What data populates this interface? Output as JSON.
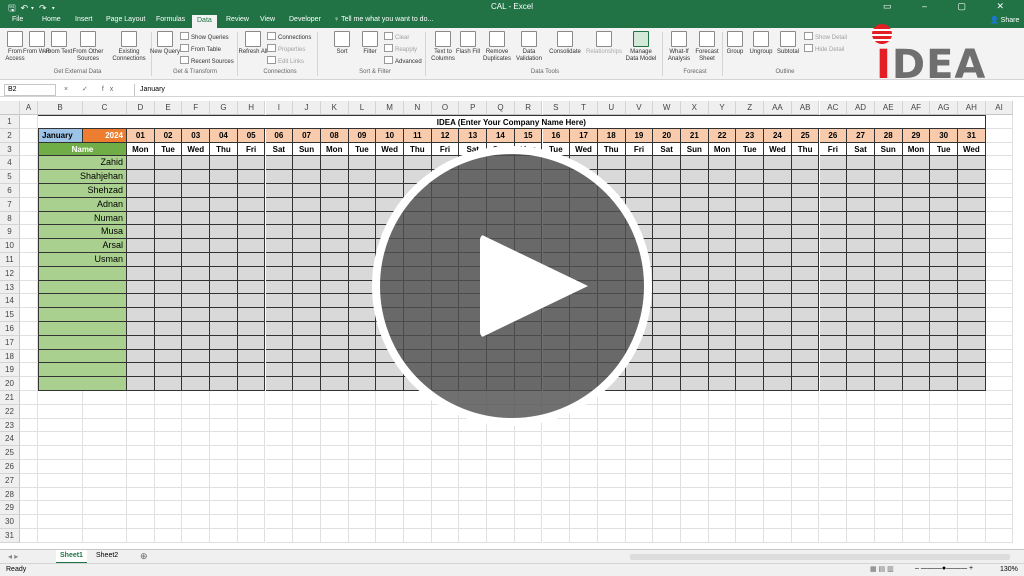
{
  "window": {
    "title": "CAL - Excel"
  },
  "ribbon_tabs": [
    "File",
    "Home",
    "Insert",
    "Page Layout",
    "Formulas",
    "Data",
    "Review",
    "View",
    "Developer"
  ],
  "active_tab": "Data",
  "tell_me": "Tell me what you want to do...",
  "share": "Share",
  "ribbon": {
    "get_external": {
      "label": "Get External Data",
      "buttons": [
        "From Access",
        "From Web",
        "From Text",
        "From Other Sources",
        "Existing Connections"
      ]
    },
    "get_transform": {
      "label": "Get & Transform",
      "new_query": "New Query",
      "show_queries": "Show Queries",
      "from_table": "From Table",
      "recent_sources": "Recent Sources"
    },
    "connections": {
      "label": "Connections",
      "refresh_all": "Refresh All",
      "connections": "Connections",
      "properties": "Properties",
      "edit_links": "Edit Links"
    },
    "sort_filter": {
      "label": "Sort & Filter",
      "sort": "Sort",
      "filter": "Filter",
      "clear": "Clear",
      "reapply": "Reapply",
      "advanced": "Advanced"
    },
    "data_tools": {
      "label": "Data Tools",
      "buttons": [
        "Text to Columns",
        "Flash Fill",
        "Remove Duplicates",
        "Data Validation",
        "Consolidate",
        "Relationships",
        "Manage Data Model"
      ]
    },
    "forecast": {
      "label": "Forecast",
      "buttons": [
        "What-If Analysis",
        "Forecast Sheet"
      ]
    },
    "outline": {
      "label": "Outline",
      "buttons": [
        "Group",
        "Ungroup",
        "Subtotal"
      ],
      "show_detail": "Show Detail",
      "hide_detail": "Hide Detail"
    }
  },
  "logo": {
    "text_i": "I",
    "text_rest": "DEA"
  },
  "formula_bar": {
    "cell_ref": "B2",
    "fx": "× ✓ fx",
    "value": "January"
  },
  "columns": [
    "A",
    "B",
    "C",
    "D",
    "E",
    "F",
    "G",
    "H",
    "I",
    "J",
    "K",
    "L",
    "M",
    "N",
    "O",
    "P",
    "Q",
    "R",
    "S",
    "T",
    "U",
    "V",
    "W",
    "X",
    "Y",
    "Z",
    "AA",
    "AB",
    "AC",
    "AD",
    "AE",
    "AF",
    "AG",
    "AH",
    "AI"
  ],
  "sheet": {
    "company_title": "IDEA (Enter Your Company Name Here)",
    "month": "January",
    "year": "2024",
    "name_header": "Name",
    "days": [
      "01",
      "02",
      "03",
      "04",
      "05",
      "06",
      "07",
      "08",
      "09",
      "10",
      "11",
      "12",
      "13",
      "14",
      "15",
      "16",
      "17",
      "18",
      "19",
      "20",
      "21",
      "22",
      "23",
      "24",
      "25",
      "26",
      "27",
      "28",
      "29",
      "30",
      "31"
    ],
    "weekdays": [
      "Mon",
      "Tue",
      "Wed",
      "Thu",
      "Fri",
      "Sat",
      "Sun",
      "Mon",
      "Tue",
      "Wed",
      "Thu",
      "Fri",
      "Sat",
      "Sun",
      "Mon",
      "Tue",
      "Wed",
      "Thu",
      "Fri",
      "Sat",
      "Sun",
      "Mon",
      "Tue",
      "Wed",
      "Thu",
      "Fri",
      "Sat",
      "Sun",
      "Mon",
      "Tue",
      "Wed"
    ],
    "names": [
      "Zahid",
      "Shahjehan",
      "Shehzad",
      "Adnan",
      "Numan",
      "Musa",
      "Arsal",
      "Usman",
      "",
      "",
      "",
      "",
      "",
      "",
      "",
      "",
      ""
    ]
  },
  "sheets": [
    "Sheet1",
    "Sheet2"
  ],
  "active_sheet": "Sheet1",
  "status": {
    "ready": "Ready",
    "zoom": "130%"
  }
}
